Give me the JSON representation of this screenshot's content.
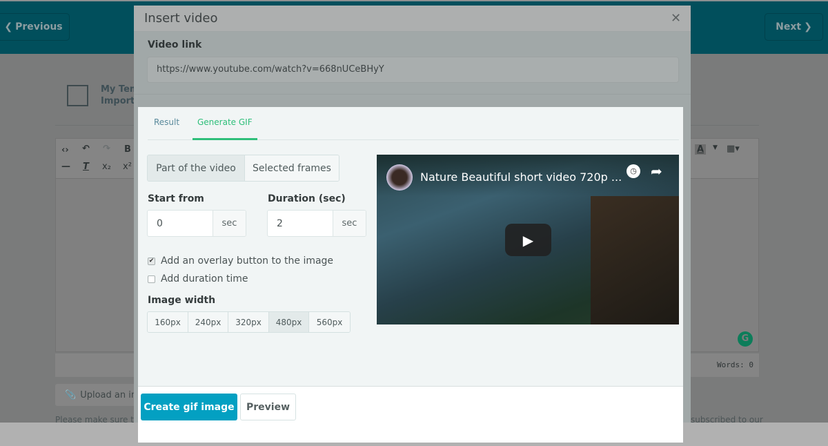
{
  "page": {
    "previous_label": "Previous",
    "next_label": "Next",
    "template_line1": "My Tem",
    "template_line2": "Import",
    "words_label": "Words: 0",
    "upload_label": "Upload an ima",
    "notice_left": "Please make sure to",
    "notice_right": "subscribed to our"
  },
  "modal": {
    "title": "Insert video",
    "video_link_label": "Video link",
    "video_link_value": "https://www.youtube.com/watch?v=668nUCeBHyY",
    "tabs": [
      {
        "label": "Result",
        "active": false
      },
      {
        "label": "Generate GIF",
        "active": true
      }
    ],
    "mode_options": [
      {
        "label": "Part of the video",
        "active": true
      },
      {
        "label": "Selected frames",
        "active": false
      }
    ],
    "start_from": {
      "label": "Start from",
      "value": "0",
      "unit": "sec"
    },
    "duration": {
      "label": "Duration (sec)",
      "value": "2",
      "unit": "sec"
    },
    "options": [
      {
        "label": "Add an overlay button to the image",
        "checked": true
      },
      {
        "label": "Add duration time",
        "checked": false
      }
    ],
    "image_width_label": "Image width",
    "widths": [
      {
        "label": "160px",
        "active": false
      },
      {
        "label": "240px",
        "active": false
      },
      {
        "label": "320px",
        "active": false
      },
      {
        "label": "480px",
        "active": true
      },
      {
        "label": "560px",
        "active": false
      }
    ],
    "video_title": "Nature Beautiful short video 720p ...",
    "create_label": "Create gif image",
    "preview_label": "Preview"
  },
  "colors": {
    "accent": "#03a0c2",
    "tab_active": "#2ebf7a"
  }
}
